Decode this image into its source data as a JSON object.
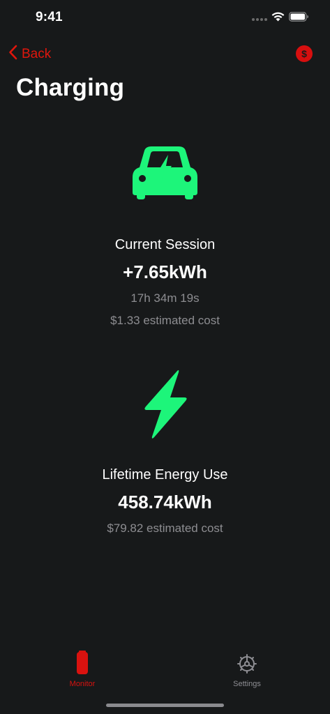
{
  "status_bar": {
    "time": "9:41"
  },
  "nav": {
    "back_label": "Back",
    "dollar_symbol": "$"
  },
  "page": {
    "title": "Charging"
  },
  "current_session": {
    "title": "Current Session",
    "energy": "+7.65kWh",
    "duration": "17h 34m 19s",
    "cost": "$1.33 estimated cost"
  },
  "lifetime": {
    "title": "Lifetime Energy Use",
    "energy": "458.74kWh",
    "cost": "$79.82 estimated cost"
  },
  "tabs": [
    {
      "label": "Monitor",
      "icon": "battery-icon",
      "active": true
    },
    {
      "label": "Settings",
      "icon": "gear-icon",
      "active": false
    }
  ],
  "colors": {
    "background": "#17191a",
    "accent_red": "#e0160c",
    "accent_green": "#1df57a",
    "secondary_text": "#8d8d91"
  }
}
